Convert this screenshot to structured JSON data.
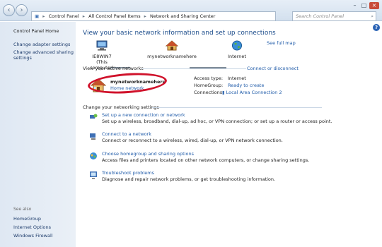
{
  "address_bar": {
    "crumbs": [
      "Control Panel",
      "All Control Panel Items",
      "Network and Sharing Center"
    ]
  },
  "search": {
    "placeholder": "Search Control Panel"
  },
  "sidebar": {
    "home": "Control Panel Home",
    "links": [
      "Change adapter settings",
      "Change advanced sharing settings"
    ],
    "see_also_title": "See also",
    "see_also": [
      "HomeGroup",
      "Internet Options",
      "Windows Firewall"
    ]
  },
  "main": {
    "heading": "View your basic network information and set up connections",
    "full_map_link": "See full map",
    "map": {
      "computer_name": "IE8WIN7",
      "computer_sub": "(This computer)",
      "network_name": "mynetworknamehere",
      "internet": "Internet"
    },
    "active_networks_title": "View your active networks",
    "connect_disconnect": "Connect or disconnect",
    "active_network": {
      "name": "mynetworknamehere",
      "type": "Home network",
      "access_type_label": "Access type:",
      "access_type_value": "Internet",
      "homegroup_label": "HomeGroup:",
      "homegroup_value": "Ready to create",
      "connections_label": "Connections:",
      "connections_value": "Local Area Connection 2"
    },
    "change_settings_title": "Change your networking settings",
    "tasks": [
      {
        "title": "Set up a new connection or network",
        "desc": "Set up a wireless, broadband, dial-up, ad hoc, or VPN connection; or set up a router or access point."
      },
      {
        "title": "Connect to a network",
        "desc": "Connect or reconnect to a wireless, wired, dial-up, or VPN network connection."
      },
      {
        "title": "Choose homegroup and sharing options",
        "desc": "Access files and printers located on other network computers, or change sharing settings."
      },
      {
        "title": "Troubleshoot problems",
        "desc": "Diagnose and repair network problems, or get troubleshooting information."
      }
    ]
  },
  "colors": {
    "link": "#1e5aa8",
    "heading": "#1e4e8c",
    "annotation_circle": "#d0122b"
  }
}
